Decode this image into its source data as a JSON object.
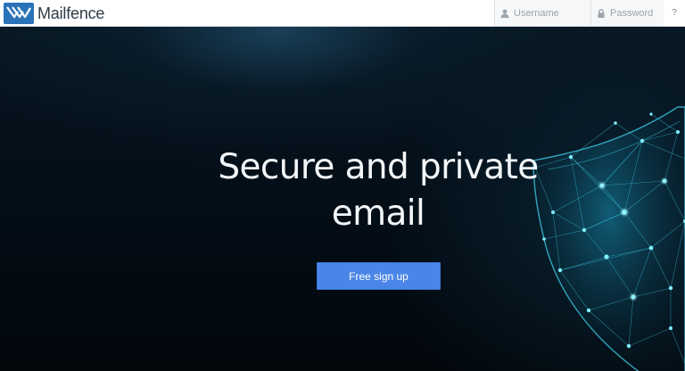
{
  "header": {
    "brand": "Mailfence",
    "username_placeholder": "Username",
    "password_placeholder": "Password",
    "help_label": "?"
  },
  "hero": {
    "headline_line1": "Secure and private",
    "headline_line2": "email",
    "signup_label": "Free sign up"
  },
  "colors": {
    "brand_blue": "#2b73b8",
    "cta_blue": "#4a86e8",
    "hero_background": "#03080d",
    "network_cyan": "#3fd6f2"
  },
  "icons": {
    "logo": "mailfence-logo-icon",
    "username": "user-icon",
    "password": "lock-icon",
    "hero_art": "network-shield-icon"
  }
}
